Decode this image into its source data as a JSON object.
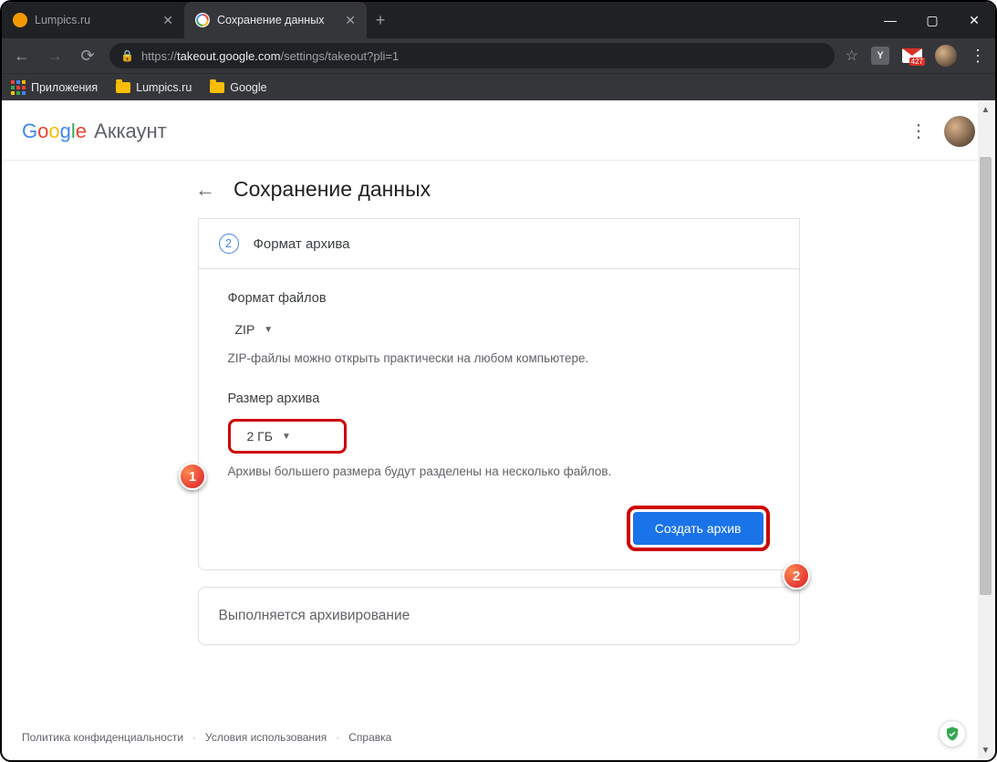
{
  "window": {
    "min": "—",
    "max": "▢",
    "close": "✕"
  },
  "tabs": [
    {
      "title": "Lumpics.ru",
      "favicon": "#f29900"
    },
    {
      "title": "Сохранение данных",
      "favicon": "google"
    }
  ],
  "toolbar": {
    "url_scheme": "https://",
    "url_host": "takeout.google.com",
    "url_path": "/settings/takeout?pli=1",
    "mail_count": "427",
    "y_label": "Y"
  },
  "bookmarks": {
    "apps": "Приложения",
    "items": [
      "Lumpics.ru",
      "Google"
    ]
  },
  "gbar": {
    "account_label": "Аккаунт"
  },
  "page": {
    "title": "Сохранение данных"
  },
  "step": {
    "number": "2",
    "title": "Формат архива"
  },
  "format": {
    "title": "Формат файлов",
    "value": "ZIP",
    "hint": "ZIP-файлы можно открыть практически на любом компьютере."
  },
  "size": {
    "title": "Размер архива",
    "value": "2 ГБ",
    "hint": "Архивы большего размера будут разделены на несколько файлов."
  },
  "actions": {
    "create": "Создать архив"
  },
  "progress": {
    "title": "Выполняется архивирование"
  },
  "footer": {
    "privacy": "Политика конфиденциальности",
    "terms": "Условия использования",
    "help": "Справка"
  },
  "markers": {
    "m1": "1",
    "m2": "2"
  }
}
